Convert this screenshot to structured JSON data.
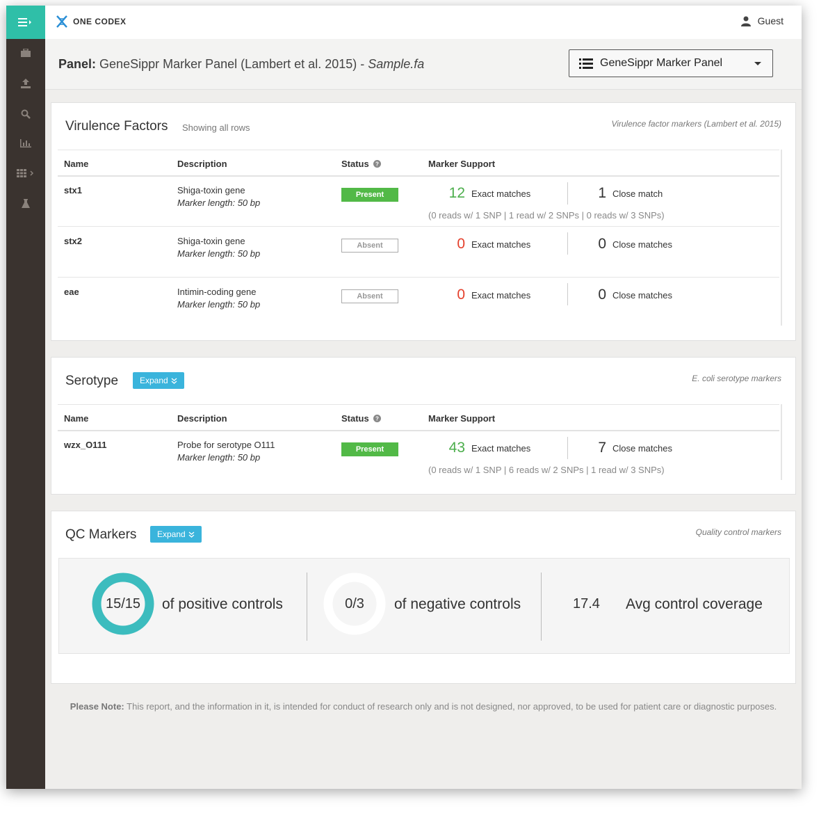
{
  "app": {
    "logo_text": "ONE CODEX",
    "user": "Guest"
  },
  "sidebar": {
    "items": [
      {
        "icon": "briefcase-icon"
      },
      {
        "icon": "upload-icon"
      },
      {
        "icon": "search-icon"
      },
      {
        "icon": "bar-chart-icon"
      },
      {
        "icon": "grid-icon"
      },
      {
        "icon": "flask-icon"
      }
    ]
  },
  "header": {
    "label": "Panel:",
    "panel_name": "GeneSippr Marker Panel (Lambert et al. 2015) - ",
    "sample": "Sample.fa",
    "select_value": "GeneSippr Marker Panel"
  },
  "columns": {
    "name": "Name",
    "description": "Description",
    "status": "Status",
    "support": "Marker Support"
  },
  "virulence": {
    "title": "Virulence Factors",
    "subtitle": "Showing all rows",
    "note": "Virulence factor markers (Lambert et al. 2015)",
    "rows": [
      {
        "name": "stx1",
        "desc": "Shiga-toxin gene",
        "length": "Marker length: 50 bp",
        "status": "Present",
        "exact": "12",
        "exact_label": "Exact matches",
        "close": "1",
        "close_label": "Close match",
        "snps": "(0 reads w/ 1 SNP  |  1 read w/ 2 SNPs  |  0 reads w/ 3 SNPs)"
      },
      {
        "name": "stx2",
        "desc": "Shiga-toxin gene",
        "length": "Marker length: 50 bp",
        "status": "Absent",
        "exact": "0",
        "exact_label": "Exact matches",
        "close": "0",
        "close_label": "Close matches"
      },
      {
        "name": "eae",
        "desc": "Intimin-coding gene",
        "length": "Marker length: 50 bp",
        "status": "Absent",
        "exact": "0",
        "exact_label": "Exact matches",
        "close": "0",
        "close_label": "Close matches"
      }
    ]
  },
  "serotype": {
    "title": "Serotype",
    "expand": "Expand",
    "note": "E. coli serotype markers",
    "rows": [
      {
        "name": "wzx_O111",
        "desc": "Probe for serotype O111",
        "length": "Marker length: 50 bp",
        "status": "Present",
        "exact": "43",
        "exact_label": "Exact matches",
        "close": "7",
        "close_label": "Close matches",
        "snps": "(0 reads w/ 1 SNP  |  6 reads w/ 2 SNPs  |  1 read w/ 3 SNPs)"
      }
    ]
  },
  "qc": {
    "title": "QC Markers",
    "expand": "Expand",
    "note": "Quality control markers",
    "positive": {
      "value": "15/15",
      "label": "of positive controls",
      "fraction": 1.0
    },
    "negative": {
      "value": "0/3",
      "label": "of negative controls",
      "fraction": 0.0
    },
    "coverage": {
      "value": "17.4",
      "label": "Avg control coverage"
    }
  },
  "footer": {
    "note_label": "Please Note:",
    "note_text": " This report, and the information in it, is intended for conduct of research only and is not designed, nor approved, to be used for patient care or diagnostic purposes."
  },
  "colors": {
    "accent": "#2fbfa8",
    "present": "#52b947",
    "expand": "#3ab4dc",
    "exact_positive": "#4cae4c",
    "exact_zero": "#e5412d"
  }
}
